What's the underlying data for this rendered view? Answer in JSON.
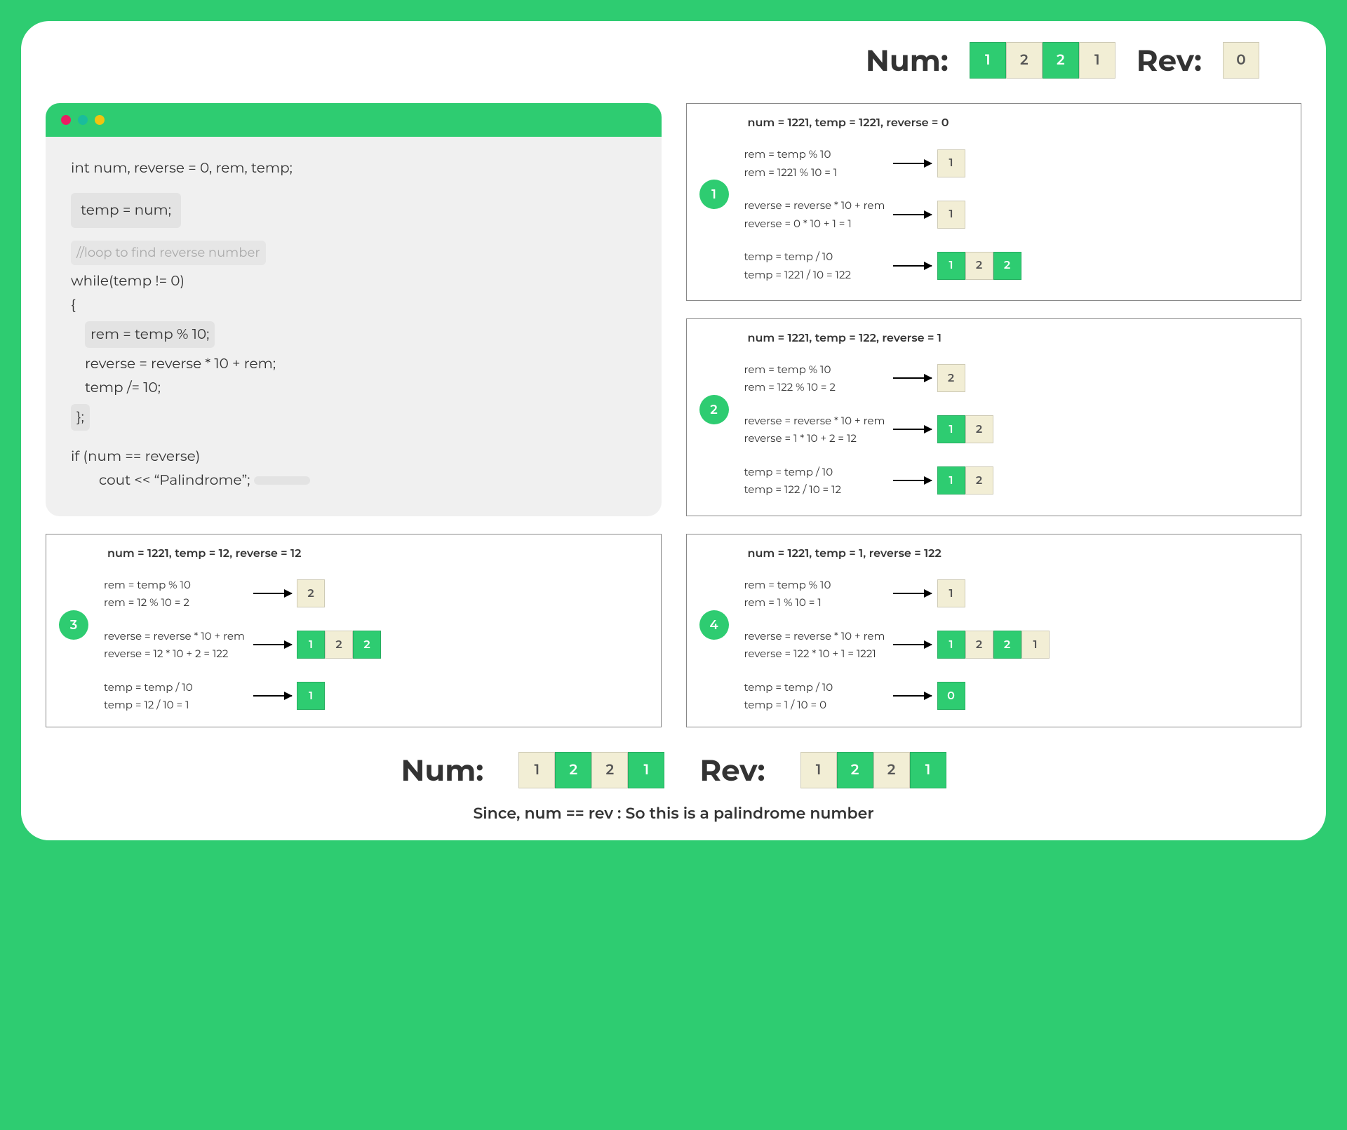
{
  "top": {
    "num_label": "Num:",
    "num_digits": [
      {
        "v": "1",
        "c": "green"
      },
      {
        "v": "2",
        "c": "cream"
      },
      {
        "v": "2",
        "c": "green"
      },
      {
        "v": "1",
        "c": "cream"
      }
    ],
    "rev_label": "Rev:",
    "rev_digits": [
      {
        "v": "0",
        "c": "cream"
      }
    ]
  },
  "code": {
    "l1": "int num, reverse = 0, rem, temp;",
    "l2": "temp = num;",
    "l3": "//loop to find reverse number",
    "l4": "while(temp != 0)",
    "l5": "{",
    "l6": "rem = temp % 10;",
    "l7": "reverse = reverse * 10 + rem;",
    "l8": "temp /= 10;",
    "l9": "};",
    "l10": "if (num == reverse)",
    "l11": "cout << “Palindrome”;"
  },
  "steps": [
    {
      "num": "1",
      "header": "num = 1221, temp = 1221, reverse = 0",
      "rows": [
        {
          "t1": "rem = temp % 10",
          "t2": "rem = 1221 % 10 = 1",
          "digits": [
            {
              "v": "1",
              "c": "cream"
            }
          ]
        },
        {
          "t1": "reverse = reverse * 10 + rem",
          "t2": "reverse = 0 * 10 + 1 = 1",
          "digits": [
            {
              "v": "1",
              "c": "cream"
            }
          ]
        },
        {
          "t1": "temp = temp / 10",
          "t2": "temp = 1221 / 10 = 122",
          "digits": [
            {
              "v": "1",
              "c": "green"
            },
            {
              "v": "2",
              "c": "cream"
            },
            {
              "v": "2",
              "c": "green"
            }
          ]
        }
      ]
    },
    {
      "num": "2",
      "header": "num = 1221, temp = 122, reverse = 1",
      "rows": [
        {
          "t1": "rem = temp % 10",
          "t2": "rem = 122 % 10 = 2",
          "digits": [
            {
              "v": "2",
              "c": "cream"
            }
          ]
        },
        {
          "t1": "reverse = reverse * 10 + rem",
          "t2": "reverse = 1 * 10 + 2 = 12",
          "digits": [
            {
              "v": "1",
              "c": "green"
            },
            {
              "v": "2",
              "c": "cream"
            }
          ]
        },
        {
          "t1": "temp = temp / 10",
          "t2": "temp = 122 / 10 = 12",
          "digits": [
            {
              "v": "1",
              "c": "green"
            },
            {
              "v": "2",
              "c": "cream"
            }
          ]
        }
      ]
    },
    {
      "num": "3",
      "header": "num = 1221, temp = 12, reverse = 12",
      "rows": [
        {
          "t1": "rem = temp % 10",
          "t2": "rem = 12 % 10 = 2",
          "digits": [
            {
              "v": "2",
              "c": "cream"
            }
          ]
        },
        {
          "t1": "reverse = reverse * 10 + rem",
          "t2": "reverse = 12 * 10 + 2 = 122",
          "digits": [
            {
              "v": "1",
              "c": "green"
            },
            {
              "v": "2",
              "c": "cream"
            },
            {
              "v": "2",
              "c": "green"
            }
          ]
        },
        {
          "t1": "temp = temp / 10",
          "t2": "temp = 12 / 10 = 1",
          "digits": [
            {
              "v": "1",
              "c": "green"
            }
          ]
        }
      ]
    },
    {
      "num": "4",
      "header": "num = 1221, temp = 1, reverse = 122",
      "rows": [
        {
          "t1": "rem = temp % 10",
          "t2": "rem = 1 % 10 = 1",
          "digits": [
            {
              "v": "1",
              "c": "cream"
            }
          ]
        },
        {
          "t1": "reverse = reverse * 10 + rem",
          "t2": "reverse = 122 * 10 + 1 = 1221",
          "digits": [
            {
              "v": "1",
              "c": "green"
            },
            {
              "v": "2",
              "c": "cream"
            },
            {
              "v": "2",
              "c": "green"
            },
            {
              "v": "1",
              "c": "cream"
            }
          ]
        },
        {
          "t1": "temp = temp / 10",
          "t2": "temp = 1 / 10 = 0",
          "digits": [
            {
              "v": "0",
              "c": "green"
            }
          ]
        }
      ]
    }
  ],
  "bottom": {
    "num_label": "Num:",
    "num_digits": [
      {
        "v": "1",
        "c": "cream"
      },
      {
        "v": "2",
        "c": "green"
      },
      {
        "v": "2",
        "c": "cream"
      },
      {
        "v": "1",
        "c": "green"
      }
    ],
    "rev_label": "Rev:",
    "rev_digits": [
      {
        "v": "1",
        "c": "cream"
      },
      {
        "v": "2",
        "c": "green"
      },
      {
        "v": "2",
        "c": "cream"
      },
      {
        "v": "1",
        "c": "green"
      }
    ]
  },
  "conclusion": "Since, num == rev : So this is a palindrome number"
}
